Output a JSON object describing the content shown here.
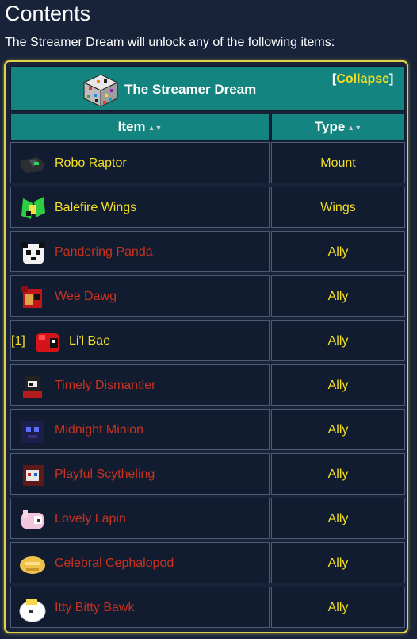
{
  "page": {
    "heading": "Contents",
    "intro": "The Streamer Dream will unlock any of the following items:"
  },
  "box": {
    "title": "The Streamer Dream",
    "title_icon": "rainbow-cube-icon",
    "collapse_open": "[",
    "collapse_label": "Collapse",
    "collapse_close": "]"
  },
  "table": {
    "columns": [
      {
        "label": "Item",
        "sort_icon": "sort-arrows-icon"
      },
      {
        "label": "Type",
        "sort_icon": "sort-arrows-icon"
      }
    ],
    "rows": [
      {
        "note": "",
        "name": "Robo Raptor",
        "type": "Mount",
        "link_color": "#f3df22",
        "icon": "robo-raptor-icon"
      },
      {
        "note": "",
        "name": "Balefire Wings",
        "type": "Wings",
        "link_color": "#f3df22",
        "icon": "balefire-wings-icon"
      },
      {
        "note": "",
        "name": "Pandering Panda",
        "type": "Ally",
        "link_color": "#c8321e",
        "icon": "panda-icon"
      },
      {
        "note": "",
        "name": "Wee Dawg",
        "type": "Ally",
        "link_color": "#c8321e",
        "icon": "dawg-icon"
      },
      {
        "note": "[1]",
        "name": "Li'l Bae",
        "type": "Ally",
        "link_color": "#f3df22",
        "icon": "lil-bae-icon"
      },
      {
        "note": "",
        "name": "Timely Dismantler",
        "type": "Ally",
        "link_color": "#c8321e",
        "icon": "dismantler-icon"
      },
      {
        "note": "",
        "name": "Midnight Minion",
        "type": "Ally",
        "link_color": "#c8321e",
        "icon": "midnight-minion-icon"
      },
      {
        "note": "",
        "name": "Playful Scytheling",
        "type": "Ally",
        "link_color": "#c8321e",
        "icon": "scytheling-icon"
      },
      {
        "note": "",
        "name": "Lovely Lapin",
        "type": "Ally",
        "link_color": "#c8321e",
        "icon": "lapin-icon"
      },
      {
        "note": "",
        "name": "Celebral Cephalopod",
        "type": "Ally",
        "link_color": "#c8321e",
        "icon": "cephalopod-icon"
      },
      {
        "note": "",
        "name": "Itty Bitty Bawk",
        "type": "Ally",
        "link_color": "#c8321e",
        "icon": "bawk-icon"
      }
    ]
  },
  "colors": {
    "header_teal": "#13847f",
    "frame_yellow": "#e2d44a",
    "link_yellow": "#f3df22",
    "link_red": "#c8321e",
    "background": "#18233a"
  }
}
